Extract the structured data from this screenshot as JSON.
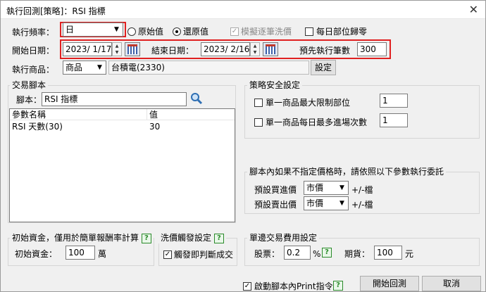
{
  "window": {
    "title": "執行回測[策略]：RSI 指標",
    "close_glyph": "✕"
  },
  "freq": {
    "label": "執行頻率：",
    "value": "日"
  },
  "price_mode": {
    "opt1": "原始值",
    "opt2": "還原值",
    "selected": "還原值"
  },
  "simulate": {
    "label": "模擬逐筆洗價",
    "checked": true,
    "disabled": true
  },
  "daily_reset": {
    "label": "每日部位歸零",
    "checked": false
  },
  "start": {
    "label": "開始日期：",
    "value": "2023/  1/17"
  },
  "end": {
    "label": "結束日期：",
    "value": "2023/  2/16"
  },
  "prefetch": {
    "label": "預先執行筆數",
    "value": "300"
  },
  "product": {
    "label": "執行商品：",
    "type": "商品",
    "name": "台積電(2330)",
    "set_button": "設定"
  },
  "script": {
    "group": "交易腳本",
    "label": "腳本：",
    "value": "RSI 指標",
    "columns": [
      "參數名稱",
      "值"
    ],
    "rows": [
      {
        "name": "RSI 天數(30)",
        "value": "30"
      }
    ]
  },
  "safety": {
    "group": "策略安全設定",
    "max_pos": {
      "label": "單一商品最大限制部位",
      "value": "1"
    },
    "max_entries": {
      "label": "單一商品每日最多進場次數",
      "value": "1"
    }
  },
  "order": {
    "group": "腳本內如果不指定價格時，請依照以下參數執行委託",
    "buy": {
      "label": "預設買進價",
      "value": "市價",
      "suffix": "+/-檔"
    },
    "sell": {
      "label": "預設賣出價",
      "value": "市價",
      "suffix": "+/-檔"
    }
  },
  "capital": {
    "group": "初始資金，僅用於簡單報酬率計算",
    "label": "初始資金：",
    "value": "100",
    "unit": "萬"
  },
  "trigger": {
    "group": "洗價觸發設定",
    "label": "觸發即判斷成交",
    "checked": true
  },
  "fee": {
    "group": "單邊交易費用設定",
    "stock_label": "股票：",
    "stock_value": "0.2",
    "pct": "%",
    "future_label": "期貨：",
    "future_value": "100",
    "unit": "元"
  },
  "footer": {
    "print_label": "啟動腳本內Print指令",
    "print_checked": true,
    "start_button": "開始回測",
    "cancel_button": "取消"
  },
  "help_glyph": "?"
}
